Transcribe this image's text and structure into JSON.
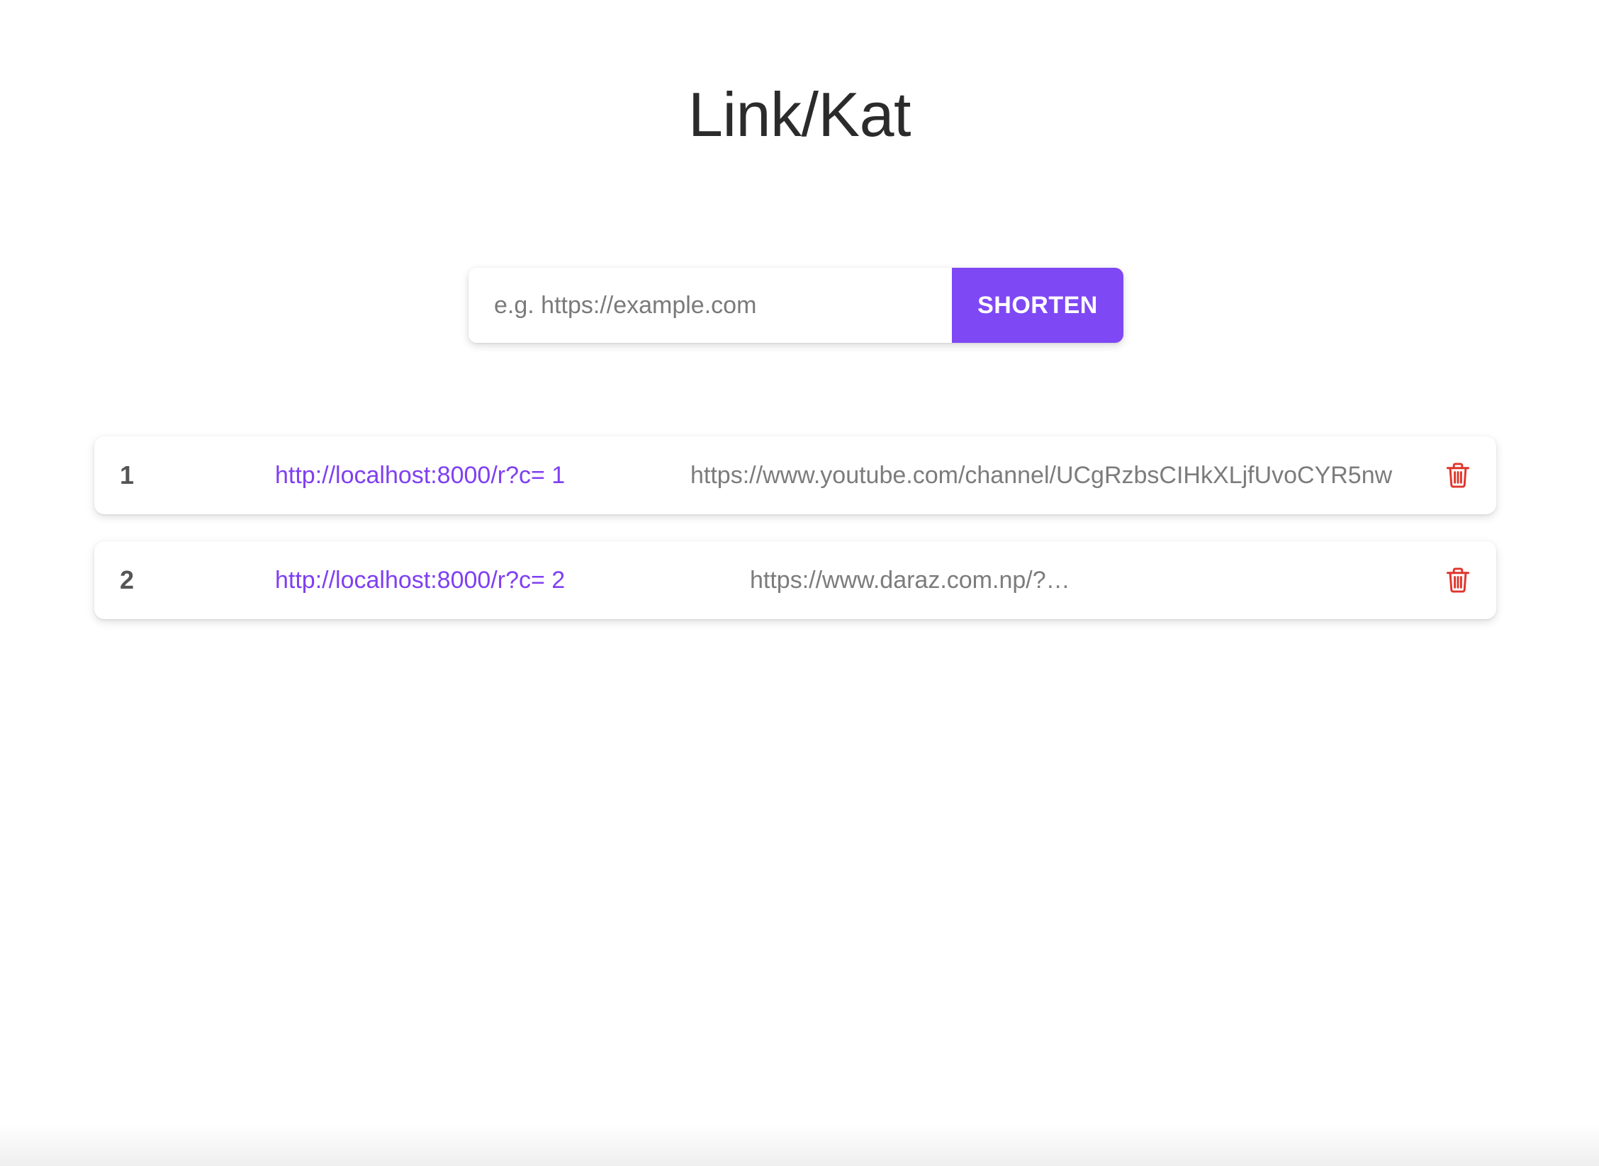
{
  "app": {
    "title": "Link/Kat"
  },
  "shorten_form": {
    "input_value": "",
    "input_placeholder": "e.g. https://example.com",
    "button_label": "SHORTEN"
  },
  "links": [
    {
      "index": "1",
      "short_url": "http://localhost:8000/r?c= 1",
      "original_url": "https://www.youtube.com/channel/UCgRzbsCIHkXLjfUvoCYR5nw",
      "delete_icon": "trash-icon"
    },
    {
      "index": "2",
      "short_url": "http://localhost:8000/r?c= 2",
      "original_url": "https://www.daraz.com.np/?…",
      "delete_icon": "trash-icon"
    }
  ],
  "colors": {
    "accent": "#7f48f5",
    "link": "#7f3ff2",
    "delete": "#e0352b",
    "title": "#2b2b2b",
    "muted_text": "#7c7c7c"
  }
}
